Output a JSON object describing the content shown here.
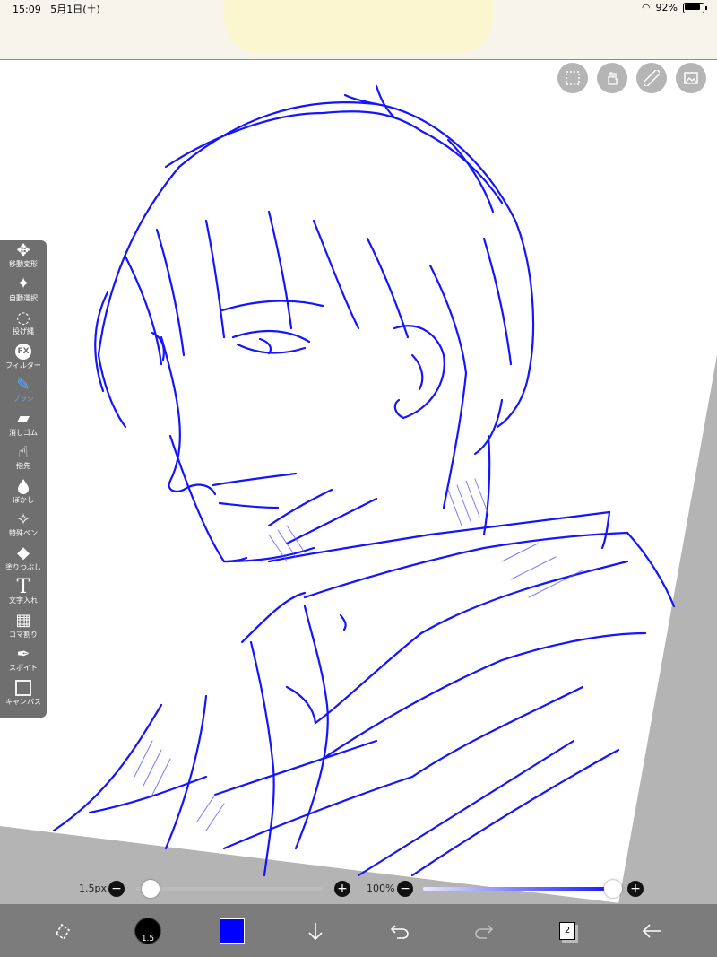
{
  "status": {
    "time": "15:09",
    "date": "5月1日(土)",
    "battery": "92%"
  },
  "top_buttons": [
    "selection-icon",
    "hand-icon",
    "ruler-icon",
    "image-icon"
  ],
  "toolbar": {
    "items": [
      {
        "label": "移動変形",
        "icon": "move-icon",
        "glyph": "✥"
      },
      {
        "label": "自動選択",
        "icon": "magic-wand-icon",
        "glyph": "✦"
      },
      {
        "label": "投げ縄",
        "icon": "lasso-icon",
        "glyph": "◌"
      },
      {
        "label": "フィルター",
        "icon": "fx-icon",
        "glyph": "FX"
      },
      {
        "label": "ブラシ",
        "icon": "brush-icon",
        "glyph": "✎"
      },
      {
        "label": "消しゴム",
        "icon": "eraser-icon",
        "glyph": "▰"
      },
      {
        "label": "指先",
        "icon": "finger-icon",
        "glyph": "☝"
      },
      {
        "label": "ぼかし",
        "icon": "drop-icon",
        "glyph": "💧"
      },
      {
        "label": "特殊ペン",
        "icon": "special-pen-icon",
        "glyph": "✧"
      },
      {
        "label": "塗りつぶし",
        "icon": "fill-icon",
        "glyph": "◆"
      },
      {
        "label": "文字入れ",
        "icon": "text-icon",
        "glyph": "T"
      },
      {
        "label": "コマ割り",
        "icon": "frame-icon",
        "glyph": "▦"
      },
      {
        "label": "スポイト",
        "icon": "eyedropper-icon",
        "glyph": "✒"
      },
      {
        "label": "キャンバス",
        "icon": "canvas-icon",
        "glyph": "□"
      }
    ],
    "active": "ブラシ"
  },
  "brush_size": {
    "label": "1.5px",
    "value": 1.5,
    "fraction": 0.03
  },
  "opacity": {
    "label": "100%",
    "value": 100,
    "fraction": 1.0
  },
  "bottom": {
    "brush_badge": "1.5",
    "color": "#0000ff",
    "layer_count": "2"
  },
  "colors": {
    "stroke": "#1a1aff",
    "toolbar_bg": "#6f6f6f",
    "active": "#5aa9ff"
  }
}
